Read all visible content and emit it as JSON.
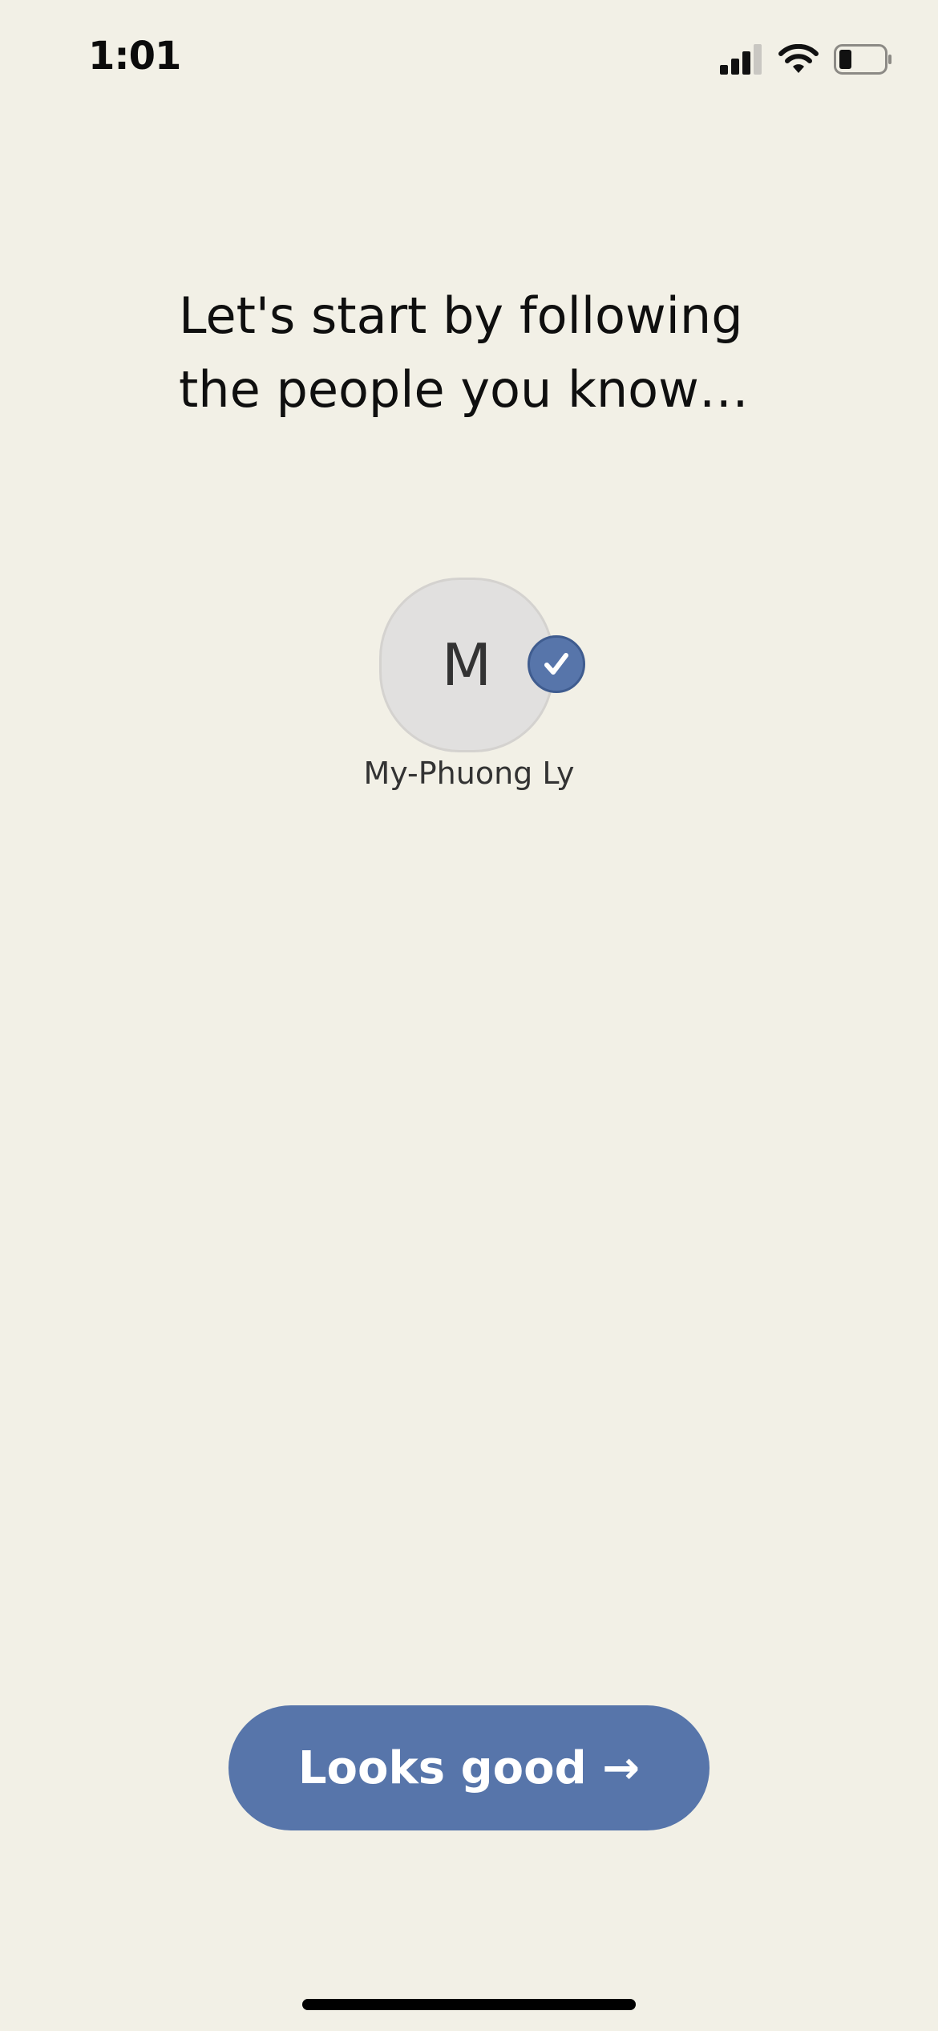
{
  "status_bar": {
    "time": "1:01",
    "icons": [
      "signal-icon",
      "wifi-icon",
      "battery-icon"
    ]
  },
  "onboarding": {
    "heading_line1": "Let's start by following",
    "heading_line2": "the people you know…"
  },
  "people": [
    {
      "initial": "M",
      "name": "My-Phuong Ly",
      "selected": true,
      "badge_icon": "checkmark-icon"
    }
  ],
  "actions": {
    "continue_label": "Looks good →"
  },
  "colors": {
    "background": "#f2f0e6",
    "accent": "#5775aa",
    "avatar_bg": "#e1e0df"
  }
}
